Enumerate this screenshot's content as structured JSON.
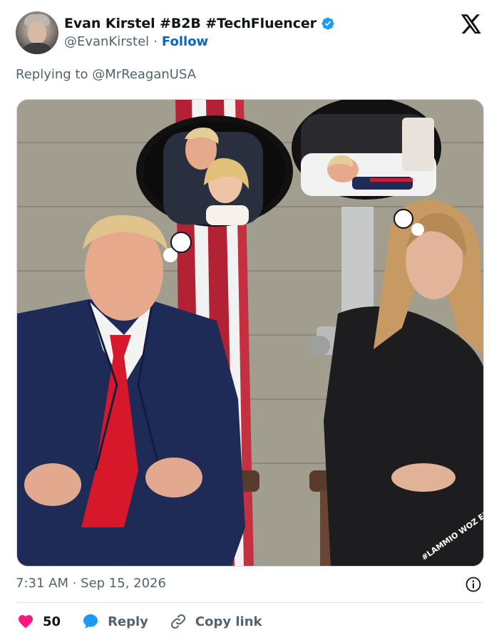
{
  "author": {
    "display_name": "Evan Kirstel #B2B #TechFluencer",
    "handle": "@EvanKirstel",
    "separator": "·",
    "follow_label": "Follow",
    "verified_color": "#1d9bf0"
  },
  "replying": {
    "prefix": "Replying to ",
    "mention": "@MrReaganUSA"
  },
  "media": {
    "watermark": "#LAMMIO WOZ ERE"
  },
  "timestamp": "7:31 AM · Sep 15, 2026",
  "actions": {
    "like_count": "50",
    "reply_label": "Reply",
    "copy_label": "Copy link"
  },
  "colors": {
    "like": "#f91880",
    "reply": "#1d9bf0",
    "link": "#0a66c2",
    "muted": "#536471"
  },
  "icons": [
    "verified-badge-icon",
    "x-logo-icon",
    "info-icon",
    "heart-icon",
    "reply-bubble-icon",
    "link-icon"
  ]
}
